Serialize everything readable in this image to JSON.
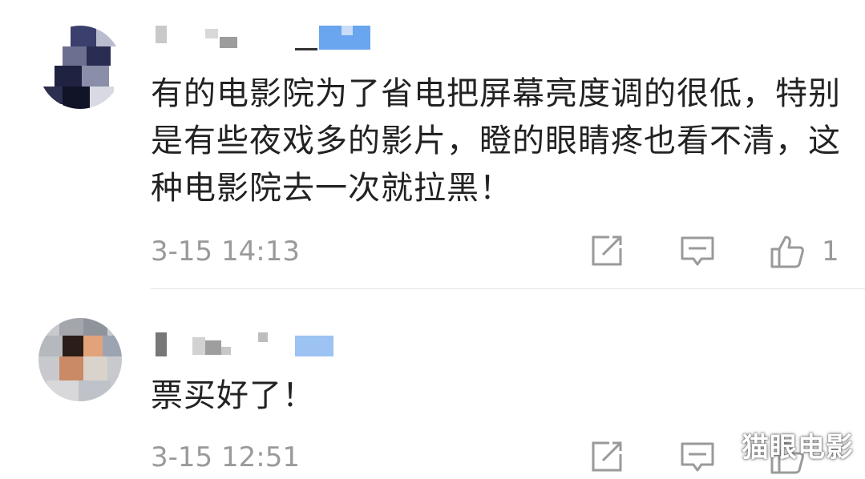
{
  "comments": [
    {
      "text": "有的电影院为了省电把屏幕亮度调的很低，特别是有些夜戏多的影片，瞪的眼睛疼也看不清，这种电影院去一次就拉黑！",
      "time": "3-15 14:13",
      "like_count": "1",
      "icons": {
        "share": "share-icon",
        "reply": "comment-icon",
        "like": "thumbs-up-icon"
      }
    },
    {
      "text": "票买好了！",
      "time": "3-15 12:51",
      "like_count": "",
      "icons": {
        "share": "share-icon",
        "reply": "comment-icon",
        "like": "thumbs-up-icon"
      }
    }
  ],
  "watermark": "猫眼电影",
  "colors": {
    "text": "#222222",
    "meta": "#9a9a9a",
    "divider": "#e6e6e6",
    "name_accent": "#6aa6ef"
  }
}
